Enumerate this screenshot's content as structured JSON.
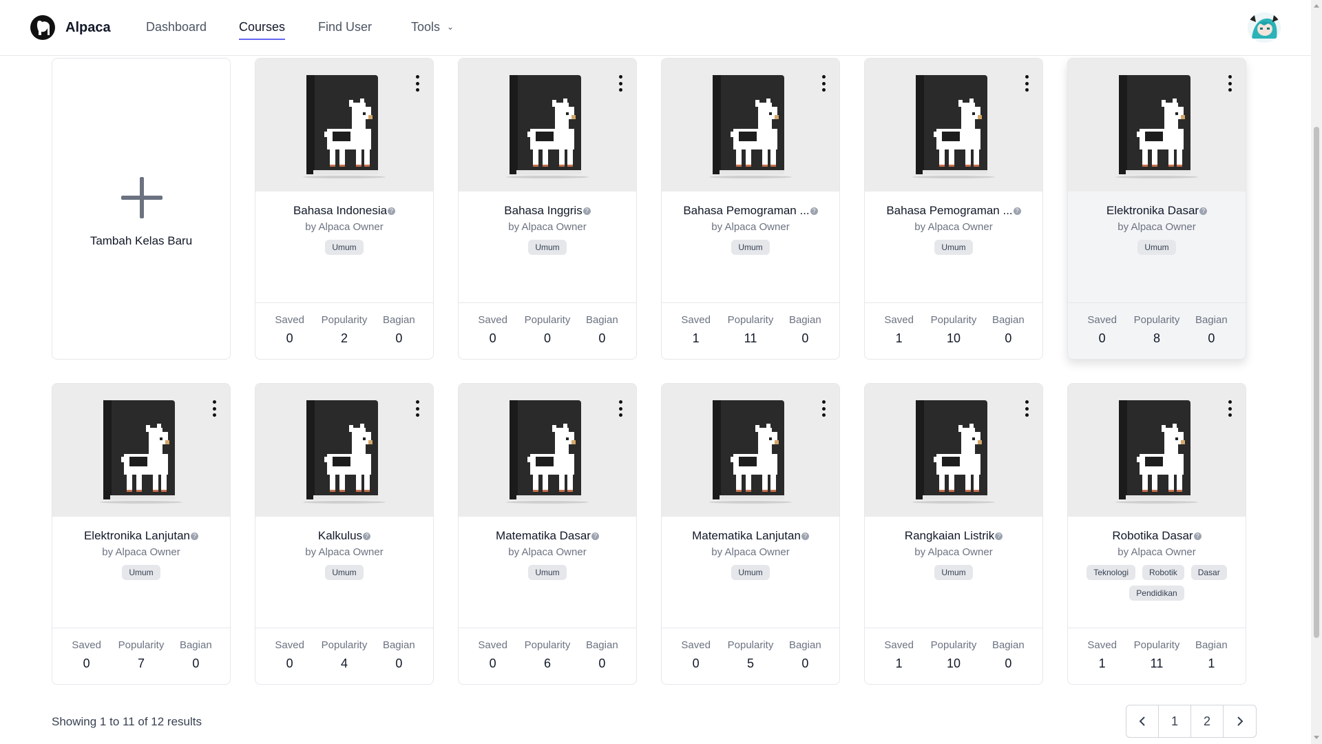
{
  "nav": {
    "brand": "Alpaca",
    "links": [
      "Dashboard",
      "Courses",
      "Find User",
      "Tools"
    ]
  },
  "add_card": {
    "label": "Tambah Kelas Baru"
  },
  "stat_labels": {
    "saved": "Saved",
    "popularity": "Popularity",
    "bagian": "Bagian"
  },
  "courses": [
    {
      "title": "Bahasa Indonesia",
      "author": "by Alpaca Owner",
      "tags": [
        "Umum"
      ],
      "saved": "0",
      "popularity": "2",
      "bagian": "0"
    },
    {
      "title": "Bahasa Inggris",
      "author": "by Alpaca Owner",
      "tags": [
        "Umum"
      ],
      "saved": "0",
      "popularity": "0",
      "bagian": "0"
    },
    {
      "title": "Bahasa Pemograman ...",
      "author": "by Alpaca Owner",
      "tags": [
        "Umum"
      ],
      "saved": "1",
      "popularity": "11",
      "bagian": "0"
    },
    {
      "title": "Bahasa Pemograman ...",
      "author": "by Alpaca Owner",
      "tags": [
        "Umum"
      ],
      "saved": "1",
      "popularity": "10",
      "bagian": "0"
    },
    {
      "title": "Elektronika Dasar",
      "author": "by Alpaca Owner",
      "tags": [
        "Umum"
      ],
      "saved": "0",
      "popularity": "8",
      "bagian": "0"
    },
    {
      "title": "Elektronika Lanjutan",
      "author": "by Alpaca Owner",
      "tags": [
        "Umum"
      ],
      "saved": "0",
      "popularity": "7",
      "bagian": "0"
    },
    {
      "title": "Kalkulus",
      "author": "by Alpaca Owner",
      "tags": [
        "Umum"
      ],
      "saved": "0",
      "popularity": "4",
      "bagian": "0"
    },
    {
      "title": "Matematika Dasar",
      "author": "by Alpaca Owner",
      "tags": [
        "Umum"
      ],
      "saved": "0",
      "popularity": "6",
      "bagian": "0"
    },
    {
      "title": "Matematika Lanjutan",
      "author": "by Alpaca Owner",
      "tags": [
        "Umum"
      ],
      "saved": "0",
      "popularity": "5",
      "bagian": "0"
    },
    {
      "title": "Rangkaian Listrik",
      "author": "by Alpaca Owner",
      "tags": [
        "Umum"
      ],
      "saved": "1",
      "popularity": "10",
      "bagian": "0"
    },
    {
      "title": "Robotika Dasar",
      "author": "by Alpaca Owner",
      "tags": [
        "Teknologi",
        "Robotik",
        "Dasar",
        "Pendidikan"
      ],
      "saved": "1",
      "popularity": "11",
      "bagian": "1"
    }
  ],
  "footer": {
    "results_text": "Showing 1 to 11 of 12 results",
    "pages": [
      "1",
      "2"
    ]
  }
}
